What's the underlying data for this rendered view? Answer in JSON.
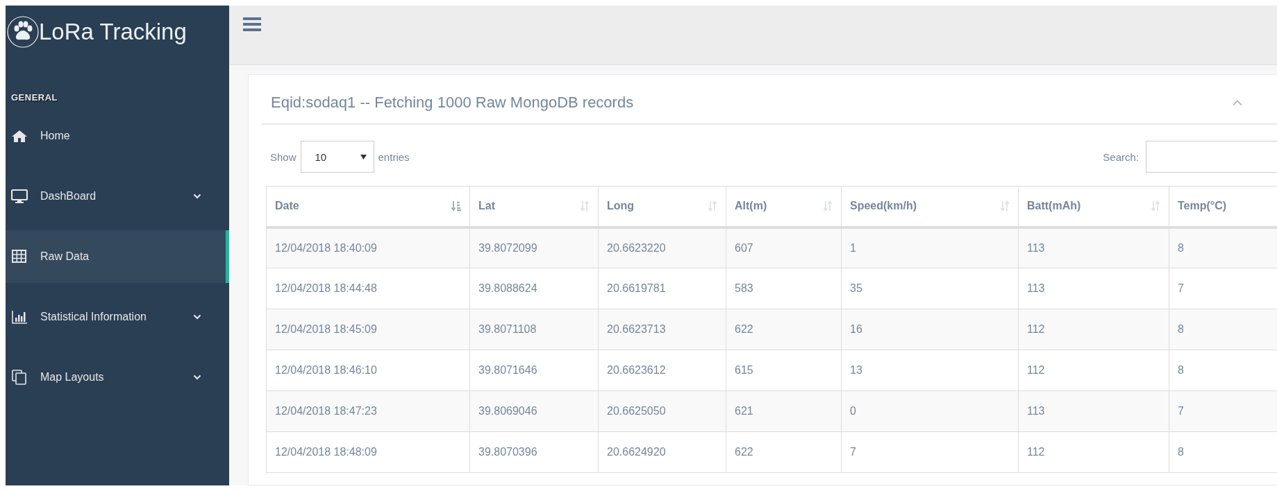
{
  "brand": {
    "title": "LoRa Tracking"
  },
  "sidebar": {
    "section": "GENERAL",
    "items": [
      {
        "label": "Home",
        "selected": false,
        "expandable": false
      },
      {
        "label": "DashBoard",
        "selected": false,
        "expandable": true
      },
      {
        "label": "Raw Data",
        "selected": true,
        "expandable": false
      },
      {
        "label": "Statistical Information",
        "selected": false,
        "expandable": true
      },
      {
        "label": "Map Layouts",
        "selected": false,
        "expandable": true
      }
    ]
  },
  "panel": {
    "title": "Eqid:sodaq1 -- Fetching 1000 Raw MongoDB records",
    "length": {
      "before": "Show",
      "value": "10",
      "after": "entries"
    },
    "search": {
      "label": "Search:"
    },
    "table": {
      "columns": [
        {
          "label": "Date",
          "sorted": true
        },
        {
          "label": "Lat",
          "sorted": false
        },
        {
          "label": "Long",
          "sorted": false
        },
        {
          "label": "Alt(m)",
          "sorted": false
        },
        {
          "label": "Speed(km/h)",
          "sorted": false
        },
        {
          "label": "Batt(mAh)",
          "sorted": false
        },
        {
          "label": "Temp(°C)"
        }
      ],
      "rows": [
        [
          "12/04/2018 18:40:09",
          "39.8072099",
          "20.6623220",
          "607",
          "1",
          "113",
          "8"
        ],
        [
          "12/04/2018 18:44:48",
          "39.8088624",
          "20.6619781",
          "583",
          "35",
          "113",
          "7"
        ],
        [
          "12/04/2018 18:45:09",
          "39.8071108",
          "20.6623713",
          "622",
          "16",
          "112",
          "8"
        ],
        [
          "12/04/2018 18:46:10",
          "39.8071646",
          "20.6623612",
          "615",
          "13",
          "112",
          "8"
        ],
        [
          "12/04/2018 18:47:23",
          "39.8069046",
          "20.6625050",
          "621",
          "0",
          "113",
          "7"
        ],
        [
          "12/04/2018 18:48:09",
          "39.8070396",
          "20.6624920",
          "622",
          "7",
          "112",
          "8"
        ]
      ]
    }
  }
}
